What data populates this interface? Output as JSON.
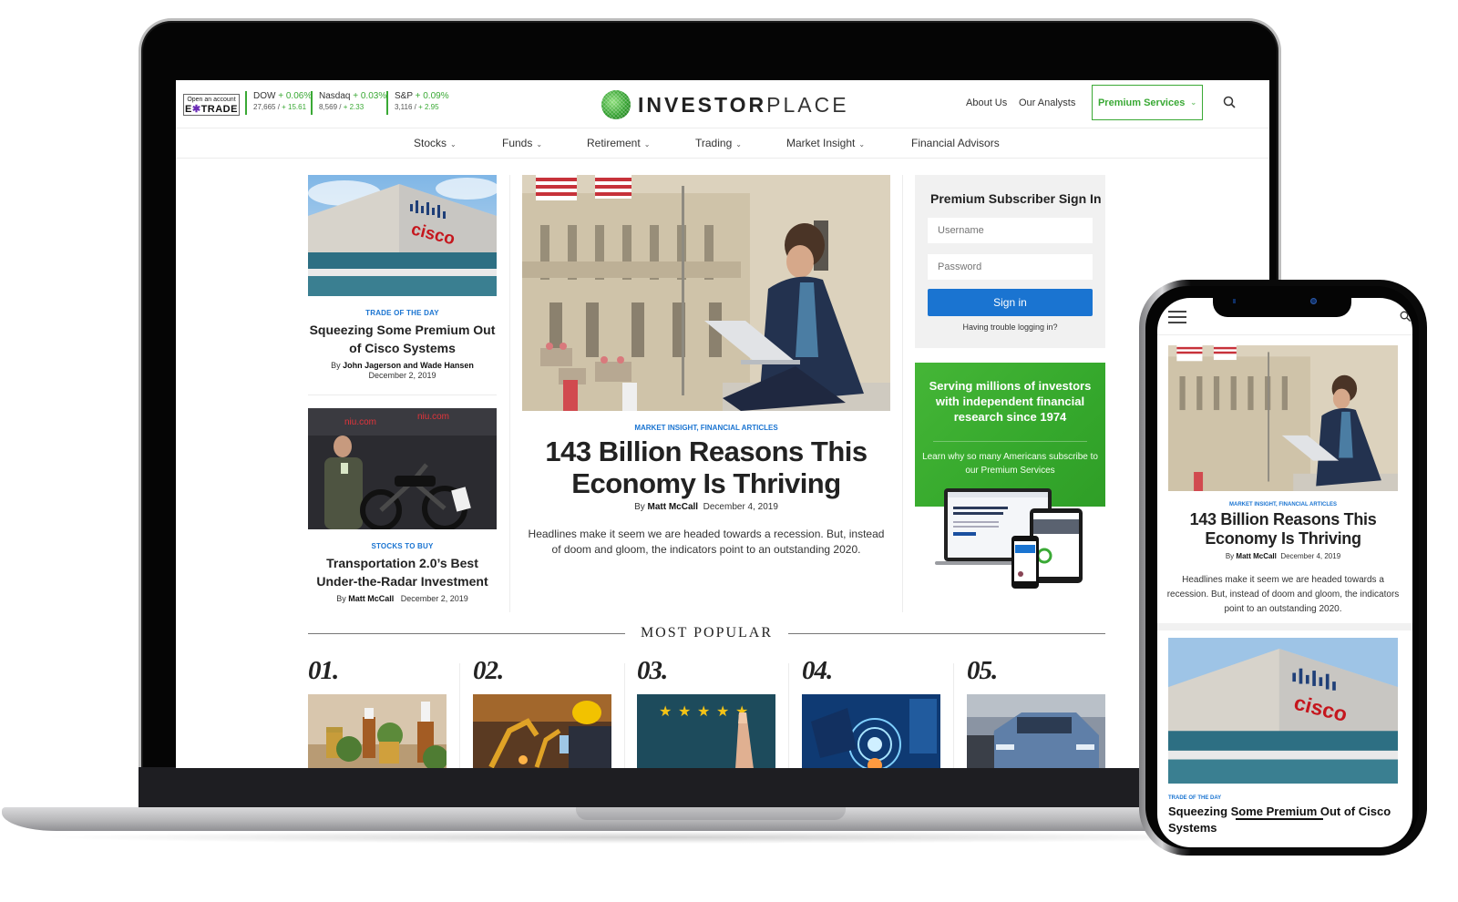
{
  "laptop": {
    "ticker": {
      "etrade": {
        "small_label": "Open an account",
        "brand": "E*TRADE"
      },
      "quotes": [
        {
          "name": "DOW",
          "change_pct": "+ 0.06%",
          "value": "27,665",
          "change_pts": "+ 15.61"
        },
        {
          "name": "Nasdaq",
          "change_pct": "+ 0.03%",
          "value": "8,569",
          "change_pts": "+ 2.33"
        },
        {
          "name": "S&P",
          "change_pct": "+ 0.09%",
          "value": "3,116",
          "change_pts": "+ 2.95"
        }
      ]
    },
    "logo": {
      "bold": "INVESTOR",
      "thin": "PLACE"
    },
    "top_links": {
      "about": "About Us",
      "analysts": "Our Analysts",
      "premium": "Premium Services"
    },
    "nav": [
      {
        "label": "Stocks",
        "has_dropdown": true
      },
      {
        "label": "Funds",
        "has_dropdown": true
      },
      {
        "label": "Retirement",
        "has_dropdown": true
      },
      {
        "label": "Trading",
        "has_dropdown": true
      },
      {
        "label": "Market Insight",
        "has_dropdown": true
      },
      {
        "label": "Financial Advisors",
        "has_dropdown": false
      }
    ],
    "side_articles": [
      {
        "category": "TRADE OF THE DAY",
        "title": "Squeezing Some Premium Out of Cisco Systems",
        "by": "By",
        "author": "John Jagerson and Wade Hansen",
        "date": "December 2, 2019"
      },
      {
        "category": "STOCKS TO BUY",
        "title": "Transportation 2.0’s Best Under-the-Radar Investment",
        "by": "By",
        "author": "Matt McCall",
        "date": "December 2, 2019"
      }
    ],
    "hero": {
      "category": "MARKET INSIGHT, FINANCIAL ARTICLES",
      "title": "143 Billion Reasons This Economy Is Thriving",
      "by": "By",
      "author": "Matt McCall",
      "date": "December 4, 2019",
      "excerpt": "Headlines make it seem we are headed towards a recession. But, instead of doom and gloom, the indicators point to an outstanding 2020."
    },
    "signin": {
      "title": "Premium Subscriber Sign In",
      "username_placeholder": "Username",
      "password_placeholder": "Password",
      "button": "Sign in",
      "trouble": "Having trouble logging in?"
    },
    "promo": {
      "headline": "Serving millions of investors with independent financial research since 1974",
      "sub": "Learn why so many Americans subscribe to our Premium Services"
    },
    "most_popular": {
      "title": "MOST POPULAR",
      "items": [
        {
          "num": "01.",
          "image": "cannabis-oil-bottles"
        },
        {
          "num": "02.",
          "image": "robotic-factory-worker"
        },
        {
          "num": "03.",
          "image": "five-star-rating"
        },
        {
          "num": "04.",
          "image": "digital-technology-hand"
        },
        {
          "num": "05.",
          "image": "electric-suv"
        }
      ]
    }
  },
  "phone": {
    "hero": {
      "category": "MARKET INSIGHT, FINANCIAL ARTICLES",
      "title": "143 Billion Reasons This Economy Is Thriving",
      "by": "By",
      "author": "Matt McCall",
      "date": "December 4, 2019",
      "excerpt": "Headlines make it seem we are headed towards a recession. But, instead of doom and gloom, the indicators point to an outstanding 2020."
    },
    "article2": {
      "category": "TRADE OF THE DAY",
      "title": "Squeezing Some Premium Out of Cisco Systems"
    }
  },
  "colors": {
    "brand_green": "#3aa935",
    "link_blue": "#1a74d1"
  }
}
